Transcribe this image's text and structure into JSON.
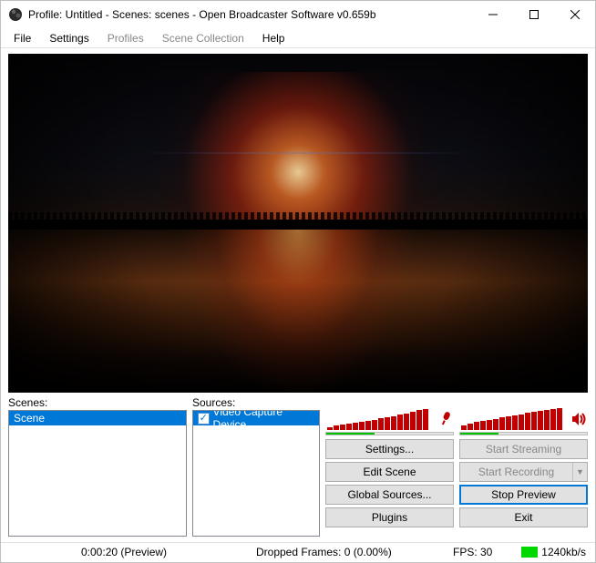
{
  "titlebar": {
    "title": "Profile: Untitled - Scenes: scenes - Open Broadcaster Software v0.659b"
  },
  "menubar": {
    "file": "File",
    "settings": "Settings",
    "profiles": "Profiles",
    "scene_collection": "Scene Collection",
    "help": "Help"
  },
  "panels": {
    "scenes_label": "Scenes:",
    "sources_label": "Sources:"
  },
  "scenes": {
    "items": [
      {
        "label": "Scene"
      }
    ]
  },
  "sources": {
    "items": [
      {
        "label": "Video Capture Device",
        "checked": true
      }
    ]
  },
  "meters": {
    "mic_bars": [
      3,
      5,
      6,
      7,
      8,
      9,
      10,
      11,
      13,
      14,
      15,
      17,
      18,
      20,
      22,
      23
    ],
    "mic_progress_pct": 38,
    "speaker_bars": [
      5,
      7,
      9,
      10,
      11,
      12,
      14,
      15,
      16,
      17,
      19,
      20,
      21,
      22,
      23,
      24
    ],
    "speaker_progress_pct": 30
  },
  "buttons": {
    "settings": "Settings...",
    "start_streaming": "Start Streaming",
    "edit_scene": "Edit Scene",
    "start_recording": "Start Recording",
    "global_sources": "Global Sources...",
    "stop_preview": "Stop Preview",
    "plugins": "Plugins",
    "exit": "Exit"
  },
  "status": {
    "time": "0:00:20 (Preview)",
    "dropped": "Dropped Frames: 0 (0.00%)",
    "fps": "FPS: 30",
    "bitrate": "1240kb/s"
  }
}
